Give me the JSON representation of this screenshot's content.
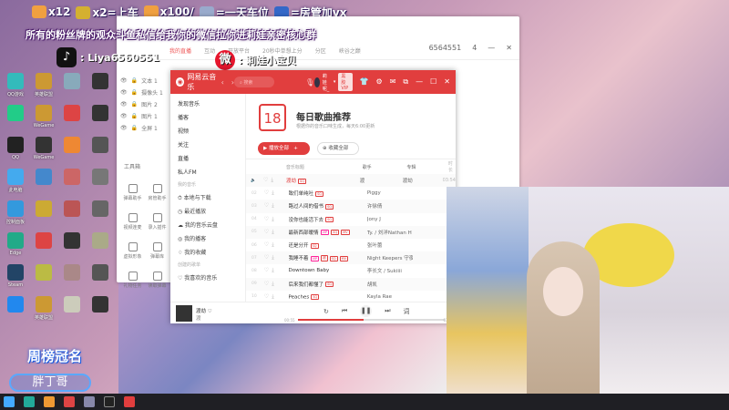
{
  "overlay": {
    "gifts": [
      {
        "text": "x12",
        "color": "#f0a040"
      },
      {
        "text": "x2=上车",
        "color": "#d4b030"
      },
      {
        "text": "x100/",
        "color": "#f0a040"
      },
      {
        "text": "=一天车位",
        "color": "#9ac"
      },
      {
        "text": "=房管加vx",
        "color": "#3468c8"
      }
    ],
    "banner": "所有的粉丝牌的观众斗鱼私信给我你的微信拉你进莉娃亲密核心群",
    "tiktok_label": ": Liya6560551",
    "weibo_label": ": 莉娃小宝贝"
  },
  "desktop": {
    "icons": [
      {
        "label": "QQ游戏",
        "color": "#3bb"
      },
      {
        "label": "英雄联盟",
        "color": "#c93"
      },
      {
        "label": "",
        "color": "#8ab"
      },
      {
        "label": "",
        "color": "#333"
      },
      {
        "label": "",
        "color": "#2c8"
      },
      {
        "label": "WeGame",
        "color": "#c93"
      },
      {
        "label": "",
        "color": "#d44"
      },
      {
        "label": "",
        "color": "#333"
      },
      {
        "label": "QQ",
        "color": "#222"
      },
      {
        "label": "WeGame",
        "color": "#333"
      },
      {
        "label": "",
        "color": "#e83"
      },
      {
        "label": "",
        "color": "#555"
      },
      {
        "label": "此电脑",
        "color": "#4ae"
      },
      {
        "label": "",
        "color": "#48c"
      },
      {
        "label": "",
        "color": "#c66"
      },
      {
        "label": "",
        "color": "#777"
      },
      {
        "label": "控制面板",
        "color": "#39d"
      },
      {
        "label": "",
        "color": "#ca3"
      },
      {
        "label": "",
        "color": "#b55"
      },
      {
        "label": "",
        "color": "#666"
      },
      {
        "label": "Edge",
        "color": "#2a8"
      },
      {
        "label": "",
        "color": "#d44"
      },
      {
        "label": "",
        "color": "#333"
      },
      {
        "label": "",
        "color": "#aa8"
      },
      {
        "label": "Steam",
        "color": "#246"
      },
      {
        "label": "",
        "color": "#bb4"
      },
      {
        "label": "",
        "color": "#a88"
      },
      {
        "label": "",
        "color": "#555"
      },
      {
        "label": "",
        "color": "#28e"
      },
      {
        "label": "英雄联盟",
        "color": "#c93"
      },
      {
        "label": "",
        "color": "#ccb"
      },
      {
        "label": "",
        "color": "#333"
      }
    ],
    "rank_badge": "周榜冠名",
    "fan_name": "胖丁哥"
  },
  "tool_window": {
    "tabs": [
      "我的直播",
      "互动",
      "开放平台",
      "20秒中单想上分",
      "分区",
      "峡谷之巅"
    ],
    "id": "6564551",
    "viewers": "4",
    "layers": [
      "文本 1",
      "摄像头 1",
      "图片 2",
      "图片 1",
      "全屏 1"
    ],
    "section": "工具箱",
    "tools": [
      "弹幕助手",
      "房管助手",
      "视频连麦",
      "录入插件",
      "虚拟形象",
      "弹幕库",
      "礼物任务",
      "读取弹幕"
    ]
  },
  "music": {
    "app_name": "网易云音乐",
    "search_placeholder": "搜索",
    "username": "莉娃呢_",
    "vip": "黑胶VIP",
    "sidebar": {
      "items": [
        "发现音乐",
        "播客",
        "视频",
        "关注",
        "直播",
        "私人FM"
      ],
      "my_music_label": "我的音乐",
      "my_items": [
        "本地与下载",
        "最近播放",
        "我的音乐云盘",
        "我的播客",
        "我的收藏"
      ],
      "created_label": "创建的歌单",
      "liked": "我喜欢的音乐"
    },
    "calendar_day": "18",
    "title": "每日歌曲推荐",
    "subtitle": "根据你的音乐口味生成，每天6:00更新",
    "play_all": "播放全部",
    "collect_all": "收藏全部",
    "columns": [
      "音乐标题",
      "歌手",
      "专辑",
      "时长"
    ],
    "songs": [
      {
        "no": "01",
        "title": "渡劫",
        "tags": [
          "SQ"
        ],
        "artist": "渡",
        "album": "渡劫",
        "time": "03:54",
        "playing": true
      },
      {
        "no": "02",
        "title": "致们单纯吐",
        "tags": [
          "SQ"
        ],
        "artist": "Piggy",
        "album": "",
        "time": ""
      },
      {
        "no": "03",
        "title": "路过人间的借书",
        "tags": [
          "SQ"
        ],
        "artist": "许徐倩",
        "album": "",
        "time": ""
      },
      {
        "no": "04",
        "title": "没你也能活下去",
        "tags": [
          "SQ"
        ],
        "artist": "Jony J",
        "album": "",
        "time": ""
      },
      {
        "no": "05",
        "title": "最新西部暧情",
        "tags": [
          "VIP",
          "SQ",
          "MV"
        ],
        "artist": "Ty. / 刘洋Nathan H",
        "album": "",
        "time": ""
      },
      {
        "no": "06",
        "title": "还是分开",
        "tags": [
          "SQ"
        ],
        "artist": "张叶蕾",
        "album": "",
        "time": ""
      },
      {
        "no": "07",
        "title": "我睡不着",
        "tags": [
          "VIP",
          "超",
          "SQ",
          "MV"
        ],
        "artist": "Night Keepers 守夜",
        "album": "",
        "time": ""
      },
      {
        "no": "08",
        "title": "Downtown Baby",
        "tags": [],
        "artist": "李长文 / Sukiiii",
        "album": "",
        "time": ""
      },
      {
        "no": "09",
        "title": "后来我们都懂了",
        "tags": [
          "SQ"
        ],
        "artist": "胡凯",
        "album": "",
        "time": ""
      },
      {
        "no": "10",
        "title": "Peaches",
        "tags": [
          "SQ"
        ],
        "artist": "Kayla Rae",
        "album": "",
        "time": ""
      }
    ],
    "player": {
      "song": "渡劫",
      "artist": "渡",
      "current": "00:55",
      "total": "03:54",
      "progress": 0.45
    }
  },
  "colors": {
    "accent": "#e13e3e"
  }
}
